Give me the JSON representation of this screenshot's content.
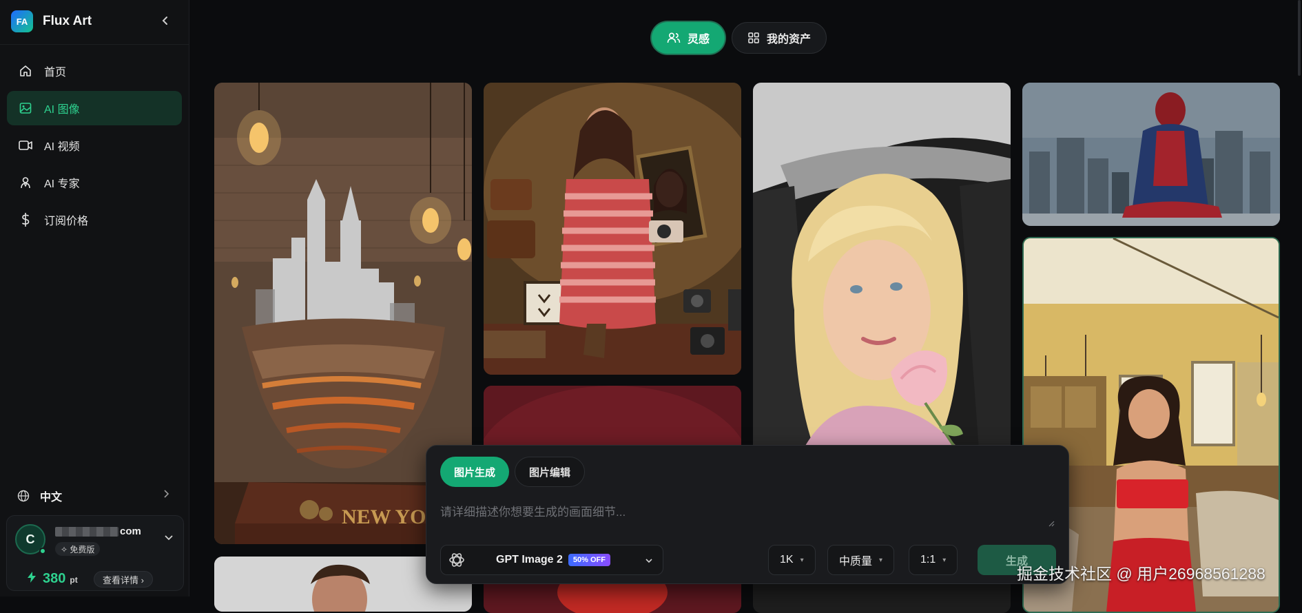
{
  "brand": {
    "name": "Flux Art",
    "logo_text": "FA"
  },
  "sidebar": {
    "items": [
      {
        "label": "首页",
        "icon": "home-icon",
        "active": false
      },
      {
        "label": "AI 图像",
        "icon": "image-icon",
        "active": true
      },
      {
        "label": "AI 视频",
        "icon": "video-icon",
        "active": false
      },
      {
        "label": "AI 专家",
        "icon": "expert-icon",
        "active": false
      },
      {
        "label": "订阅价格",
        "icon": "dollar-icon",
        "active": false
      }
    ],
    "language": "中文"
  },
  "user": {
    "avatar_letter": "C",
    "email_suffix": "com",
    "plan": "✧ 免费版",
    "points": "380",
    "points_unit": "pt",
    "details_label": "查看详情 ›"
  },
  "top_tabs": [
    {
      "label": "灵感",
      "icon": "users-icon",
      "active": true
    },
    {
      "label": "我的资产",
      "icon": "grid-icon",
      "active": false
    }
  ],
  "gallery": {
    "city_caption": "NEW YORK"
  },
  "prompt_panel": {
    "mode_tabs": [
      {
        "label": "图片生成",
        "active": true
      },
      {
        "label": "图片编辑",
        "active": false
      }
    ],
    "placeholder": "请详细描述你想要生成的画面细节...",
    "model": {
      "name": "GPT Image 2",
      "badge": "50% OFF"
    },
    "resolution": "1K",
    "quality": "中质量",
    "ratio": "1:1",
    "generate_label": "生成"
  },
  "watermark": "掘金技术社区 @ 用户26968561288",
  "colors": {
    "accent": "#14a873",
    "accent_text": "#2ed18f",
    "background": "#0b0c0e",
    "sidebar": "#111214"
  }
}
